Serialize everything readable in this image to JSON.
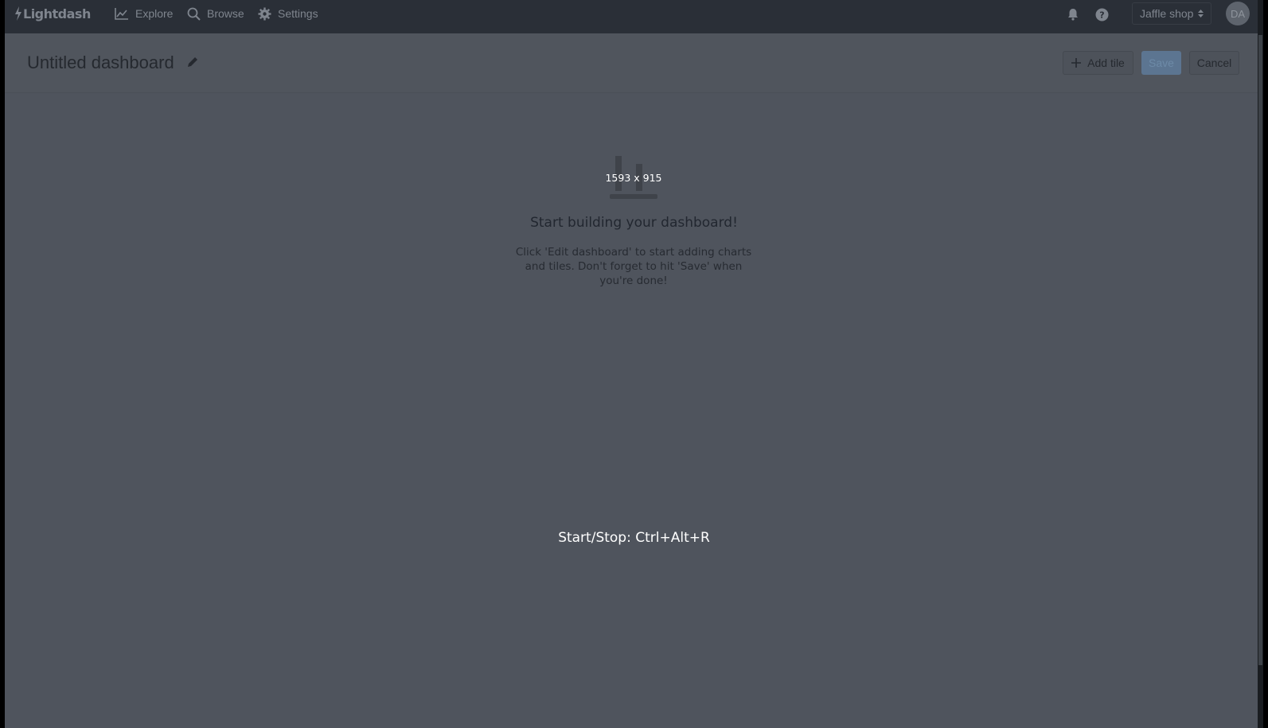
{
  "navbar": {
    "logo_text": "Lightdash",
    "items": [
      {
        "label": "Explore",
        "icon": "chart-icon"
      },
      {
        "label": "Browse",
        "icon": "search-icon"
      },
      {
        "label": "Settings",
        "icon": "gear-icon"
      }
    ],
    "project_selector": "Jaffle shop",
    "avatar_initials": "DA"
  },
  "header": {
    "title": "Untitled dashboard",
    "buttons": {
      "add_tile": "Add tile",
      "save": "Save",
      "cancel": "Cancel"
    }
  },
  "empty_state": {
    "dimensions_overlay": "1593 x 915",
    "title": "Start building your dashboard!",
    "text": "Click 'Edit dashboard' to start adding charts and tiles. Don't forget to hit 'Save' when you're done!"
  },
  "overlay_hint": "Start/Stop: Ctrl+Alt+R",
  "colors": {
    "navbar_bg": "#2a2f37",
    "page_bg": "#4f545d",
    "primary_button": "#5c7591"
  }
}
